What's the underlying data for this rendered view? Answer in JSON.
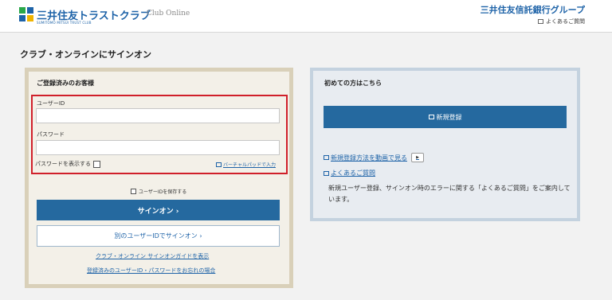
{
  "header": {
    "logo_text_jp": "三井住友トラストクラブ",
    "logo_text_en": "SUMITOMO MITSUI TRUST CLUB",
    "logo_sub": "Club Online",
    "group_name": "三井住友信託銀行グループ",
    "faq_link": "よくあるご質問"
  },
  "page_title": "クラブ・オンラインにサインオン",
  "login_panel": {
    "heading": "ご登録済みのお客様",
    "user_id_label": "ユーザーID",
    "user_id_value": "",
    "password_label": "パスワード",
    "password_value": "",
    "show_password_label": "パスワードを表示する",
    "virtual_keyboard_link": "バーチャルパッドで入力",
    "save_id_label": "ユーザーIDを保存する",
    "signon_button": "サインオン ›",
    "other_id_button": "別のユーザーIDでサインオン ›",
    "guide_link": "クラブ・オンライン サインオンガイドを表示",
    "forgot_link": "登録済みのユーザーID・パスワードをお忘れの場合"
  },
  "new_panel": {
    "heading": "初めての方はこちら",
    "register_button": "新規登録",
    "video_link": "新規登録方法を動画で見る",
    "video_icon": "▶",
    "faq_link": "よくあるご質問",
    "info_text": "新規ユーザー登録、サインオン時のエラーに関する「よくあるご質問」をご案内しています。"
  },
  "colors": {
    "brand_blue": "#1e63a8",
    "button_blue": "#25699f",
    "highlight_red": "#d0202a",
    "login_border": "#d9d0b9",
    "login_bg": "#f3f0e8",
    "new_border": "#c4d2df",
    "new_bg": "#e8ecf1"
  }
}
